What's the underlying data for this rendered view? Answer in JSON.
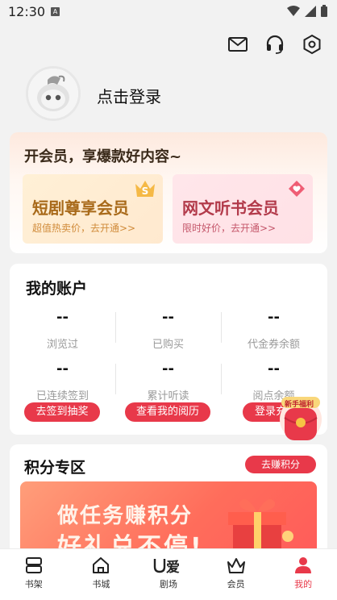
{
  "status": {
    "time": "12:30",
    "a_label": "A"
  },
  "header": {
    "login_text": "点击登录"
  },
  "vip": {
    "title": "开会员，享爆款好内容~",
    "boxes": [
      {
        "name": "短剧尊享会员",
        "sub": "超值热卖价，去开通>>",
        "badge": "S"
      },
      {
        "name": "网文听书会员",
        "sub": "限时好价，去开通>>"
      }
    ]
  },
  "account": {
    "title": "我的账户",
    "stats": [
      {
        "value": "--",
        "label": "浏览过"
      },
      {
        "value": "--",
        "label": "已购买"
      },
      {
        "value": "--",
        "label": "代金券余额"
      },
      {
        "value": "--",
        "label": "已连续签到"
      },
      {
        "value": "--",
        "label": "累计听读"
      },
      {
        "value": "--",
        "label": "阅点余额"
      }
    ],
    "buttons": [
      "去签到抽奖",
      "查看我的阅历",
      "登录充值"
    ]
  },
  "redpacket": {
    "label": "新手福利"
  },
  "points": {
    "title": "积分专区",
    "earn_button": "去赚积分",
    "banner_line1": "做任务赚积分",
    "banner_line2": "好礼兑不停!"
  },
  "tabs": [
    {
      "label": "书架",
      "icon": "bookshelf-icon"
    },
    {
      "label": "书城",
      "icon": "home-icon"
    },
    {
      "label": "剧场",
      "icon": "theater-icon"
    },
    {
      "label": "会员",
      "icon": "crown-icon"
    },
    {
      "label": "我的",
      "icon": "person-icon",
      "active": true
    }
  ],
  "colors": {
    "accent": "#e8394a",
    "gold": "#a86a1a"
  }
}
